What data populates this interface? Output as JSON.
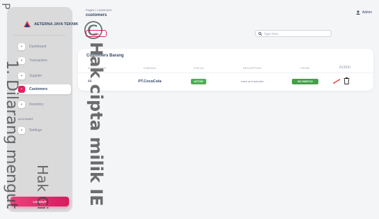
{
  "brand": {
    "name": "AETERNA JAYA TEKNIK"
  },
  "sidebar": {
    "items": [
      {
        "label": "Dashboard",
        "icon": "dashboard-icon"
      },
      {
        "label": "Transaction",
        "icon": "transaction-icon"
      },
      {
        "label": "Supplier",
        "icon": "supplier-icon"
      },
      {
        "label": "Customers",
        "icon": "customers-icon",
        "active": true
      },
      {
        "label": "Inventory",
        "icon": "inventory-icon"
      },
      {
        "label": "Settings",
        "icon": "settings-icon"
      }
    ],
    "section_label": "ACCOUNT",
    "logout_label": "LOGOUT"
  },
  "header": {
    "breadcrumb": "Pages / customers",
    "title": "customers",
    "user": "Admin"
  },
  "toolbar": {
    "add_label": "ADD",
    "search_placeholder": "Type here..."
  },
  "table": {
    "title": "Customers Barang",
    "columns": [
      "ID CUSTOMER",
      "COMPANY",
      "STATUS",
      "DESCRIPTION",
      "PHONE",
      "Action"
    ],
    "rows": [
      {
        "id": "44",
        "company": "PT.CocaCola",
        "status": "ACTIVE",
        "description": "valve and actuator",
        "phone": "021 59837111"
      }
    ]
  },
  "colors": {
    "accent": "#e91e63",
    "success": "#4caf50"
  },
  "watermark": {
    "copyright_symbol": "©",
    "main": "Hak cipta milik IE",
    "line1": "1. Dilarang mengut",
    "line2": "Hak Ci",
    "edge": "P"
  }
}
